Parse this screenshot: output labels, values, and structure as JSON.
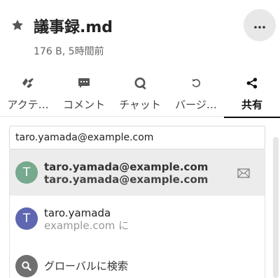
{
  "file": {
    "title": "議事録.md",
    "meta": "176 B, 5時間前"
  },
  "icons": {
    "favorite": "star-icon",
    "more": "more-horizontal-icon",
    "mail": "mail-icon",
    "search": "search-icon"
  },
  "tabs": [
    {
      "label": "アクテ…",
      "icon": "lightning-icon",
      "active": false
    },
    {
      "label": "コメント",
      "icon": "comment-icon",
      "active": false
    },
    {
      "label": "チャット",
      "icon": "chat-icon",
      "active": false
    },
    {
      "label": "バージ…",
      "icon": "history-icon",
      "active": false
    },
    {
      "label": "共有",
      "icon": "share-icon",
      "active": true
    }
  ],
  "share": {
    "search_value": "taro.yamada@example.com",
    "results": [
      {
        "avatar_letter": "T",
        "avatar_color": "#76a98d",
        "primary": "taro.yamada@example.com",
        "secondary": "taro.yamada@example.com",
        "selected": true
      },
      {
        "avatar_letter": "T",
        "avatar_color": "#5e67b0",
        "primary": "taro.yamada",
        "secondary": "example.com に",
        "selected": false
      }
    ],
    "global_search_label": "グローバルに検索"
  },
  "colors": {
    "selected_row": "#ececec",
    "search_avatar": "#707070"
  }
}
